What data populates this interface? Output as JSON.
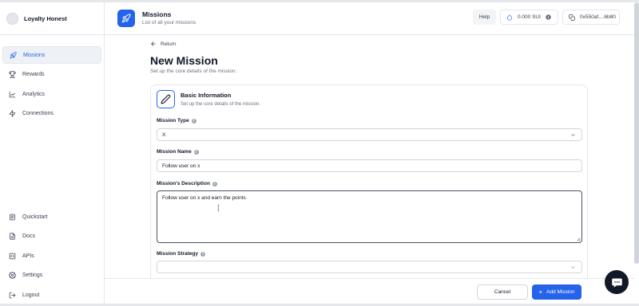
{
  "brand": {
    "name": "Loyalty Honest"
  },
  "sidebar": {
    "top_items": [
      {
        "label": "Missions",
        "icon": "rocket-icon",
        "active": true
      },
      {
        "label": "Rewards",
        "icon": "trophy-icon"
      },
      {
        "label": "Analytics",
        "icon": "chart-line-icon"
      },
      {
        "label": "Connections",
        "icon": "plug-icon"
      }
    ],
    "bottom_items": [
      {
        "label": "Quickstart",
        "icon": "quickstart-icon"
      },
      {
        "label": "Docs",
        "icon": "doc-icon"
      },
      {
        "label": "APIs",
        "icon": "code-icon"
      },
      {
        "label": "Settings",
        "icon": "gear-icon"
      },
      {
        "label": "Logout",
        "icon": "logout-icon"
      }
    ]
  },
  "header": {
    "title": "Missions",
    "subtitle": "List of all your missions",
    "help_label": "Help",
    "balance": "0.000 SUI",
    "address": "0x550af....6b80"
  },
  "page": {
    "back_label": "Return",
    "title": "New Mission",
    "subtitle": "Set up the core details of the mission."
  },
  "card": {
    "title": "Basic Information",
    "subtitle": "Set up the core details of the mission."
  },
  "form": {
    "type_label": "Mission Type",
    "type_value": "X",
    "name_label": "Mission Name",
    "name_value": "Follow user on x",
    "description_label": "Mission's Description",
    "description_value": "Follow user on x and earn the points",
    "strategy_label": "Mission Strategy",
    "strategy_value": ""
  },
  "footer": {
    "cancel_label": "Cancel",
    "add_label": "Add Mission"
  },
  "colors": {
    "accent": "#2563eb",
    "chat_button": "#111827"
  }
}
